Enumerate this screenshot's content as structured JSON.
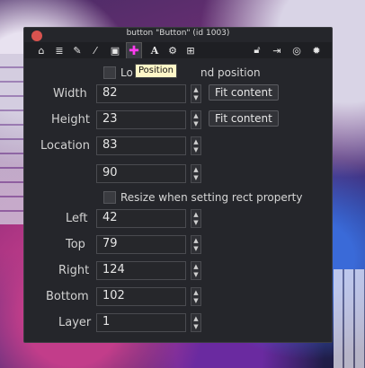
{
  "window": {
    "title": "button \"Button\" (id 1003)"
  },
  "toolbar": {
    "icons": [
      "home-icon",
      "database-icon",
      "pencil-icon",
      "magic-wand-icon",
      "image-icon",
      "move-icon",
      "text-icon",
      "gears-icon",
      "grid-icon",
      "lock-open-icon",
      "login-icon",
      "target-icon",
      "settings-icon"
    ],
    "active_icon": "move-icon",
    "tooltip": "Position"
  },
  "lock_row": {
    "label_left": "Lo",
    "label_right": "nd position"
  },
  "fields": {
    "width_label": "Width",
    "width_value": "82",
    "height_label": "Height",
    "height_value": "23",
    "location_label": "Location",
    "location_x": "83",
    "location_y": "90",
    "left_label": "Left",
    "left_value": "42",
    "top_label": "Top",
    "top_value": "79",
    "right_label": "Right",
    "right_value": "124",
    "bottom_label": "Bottom",
    "bottom_value": "102",
    "layer_label": "Layer",
    "layer_value": "1"
  },
  "buttons": {
    "fit_content_1": "Fit content",
    "fit_content_2": "Fit content"
  },
  "resize_option": {
    "label": "Resize when setting rect property"
  },
  "colors": {
    "accent": "#ff3cf0",
    "panel_bg": "#25262b",
    "close": "#d9534f",
    "tooltip_bg": "#fff7c8"
  }
}
